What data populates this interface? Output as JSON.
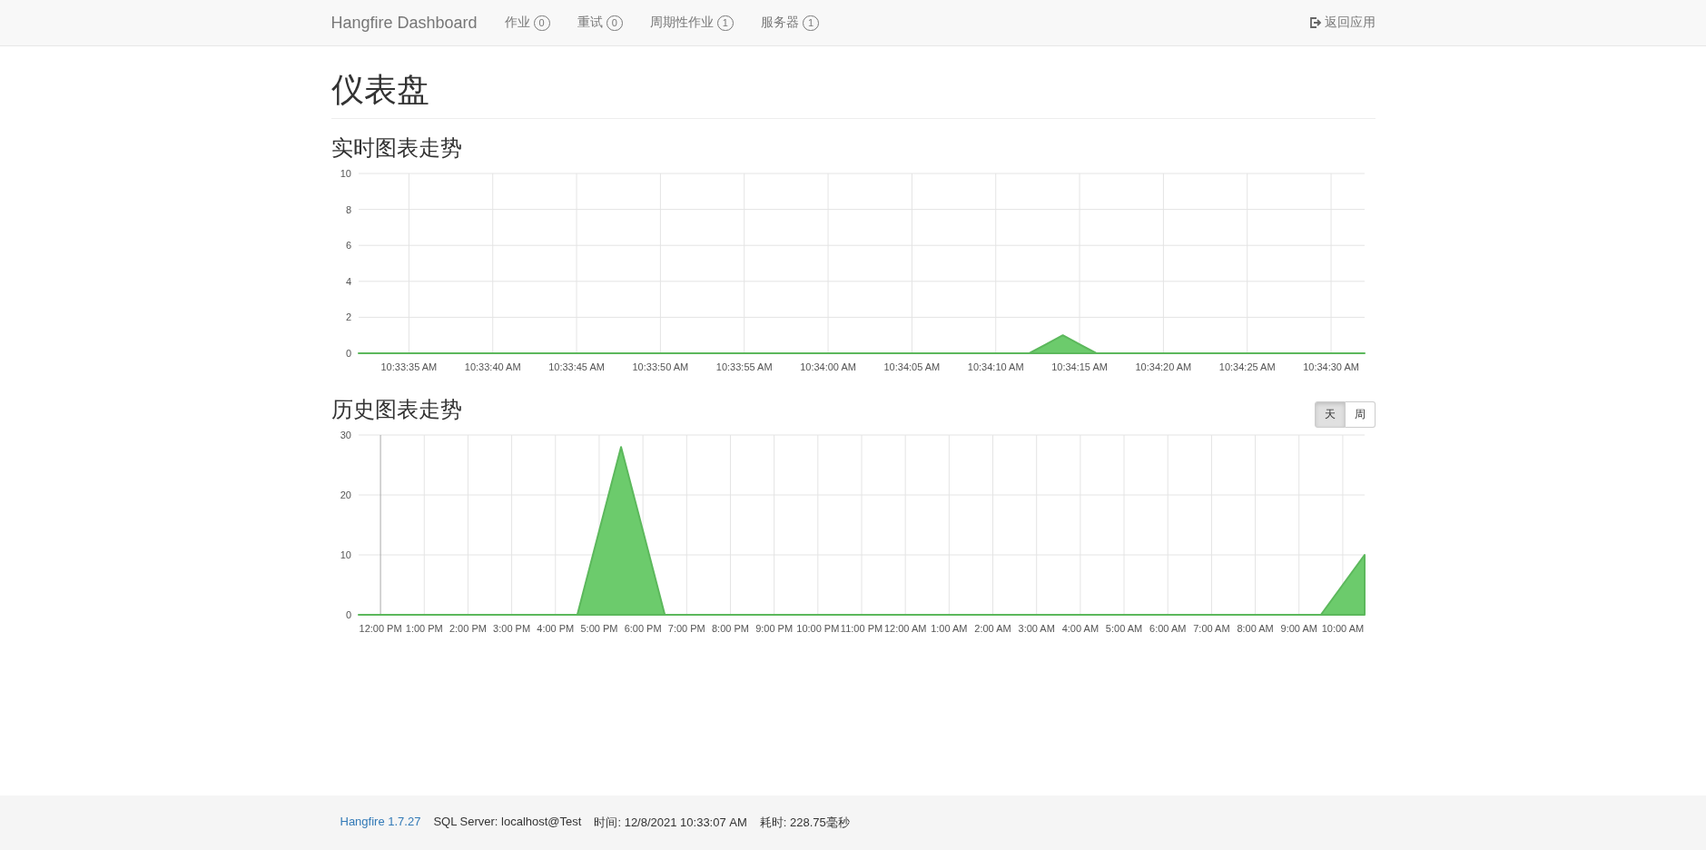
{
  "navbar": {
    "brand": "Hangfire Dashboard",
    "items": [
      {
        "label": "作业",
        "count": "0"
      },
      {
        "label": "重试",
        "count": "0"
      },
      {
        "label": "周期性作业",
        "count": "1"
      },
      {
        "label": "服务器",
        "count": "1"
      }
    ],
    "back_link": "返回应用"
  },
  "page_title": "仪表盘",
  "realtime": {
    "title": "实时图表走势",
    "chart_data": {
      "type": "area",
      "grid": true,
      "ylim": [
        0,
        10
      ],
      "yticks": [
        0,
        2,
        4,
        6,
        8,
        10
      ],
      "categories": [
        null,
        null,
        null,
        "10:33:35 AM",
        null,
        null,
        null,
        null,
        "10:33:40 AM",
        null,
        null,
        null,
        null,
        "10:33:45 AM",
        null,
        null,
        null,
        null,
        "10:33:50 AM",
        null,
        null,
        null,
        null,
        "10:33:55 AM",
        null,
        null,
        null,
        null,
        "10:34:00 AM",
        null,
        null,
        null,
        null,
        "10:34:05 AM",
        null,
        null,
        null,
        null,
        "10:34:10 AM",
        null,
        null,
        null,
        null,
        "10:34:15 AM",
        null,
        null,
        null,
        null,
        "10:34:20 AM",
        null,
        null,
        null,
        null,
        "10:34:25 AM",
        null,
        null,
        null,
        null,
        "10:34:30 AM",
        null,
        null
      ],
      "series": [
        {
          "color": "#6ccb6c",
          "values": [
            0,
            0,
            0,
            0,
            0,
            0,
            0,
            0,
            0,
            0,
            0,
            0,
            0,
            0,
            0,
            0,
            0,
            0,
            0,
            0,
            0,
            0,
            0,
            0,
            0,
            0,
            0,
            0,
            0,
            0,
            0,
            0,
            0,
            0,
            0,
            0,
            0,
            0,
            0,
            0,
            0,
            0.5,
            1,
            0.5,
            0,
            0,
            0,
            0,
            0,
            0,
            0,
            0,
            0,
            0,
            0,
            0,
            0,
            0,
            0,
            0,
            0
          ]
        }
      ]
    }
  },
  "history": {
    "title": "历史图表走势",
    "ranges": [
      {
        "label": "天",
        "selected": true
      },
      {
        "label": "周",
        "selected": false
      }
    ],
    "chart_data": {
      "type": "area",
      "grid": true,
      "ylim": [
        0,
        30
      ],
      "yticks": [
        0,
        10,
        20,
        30
      ],
      "categories": [
        null,
        "12:00 PM",
        null,
        "1:00 PM",
        null,
        "2:00 PM",
        null,
        "3:00 PM",
        null,
        "4:00 PM",
        null,
        "5:00 PM",
        null,
        "6:00 PM",
        null,
        "7:00 PM",
        null,
        "8:00 PM",
        null,
        "9:00 PM",
        null,
        "10:00 PM",
        null,
        "11:00 PM",
        null,
        "12:00 AM",
        null,
        "1:00 AM",
        null,
        "2:00 AM",
        null,
        "3:00 AM",
        null,
        "4:00 AM",
        null,
        "5:00 AM",
        null,
        "6:00 AM",
        null,
        "7:00 AM",
        null,
        "8:00 AM",
        null,
        "9:00 AM",
        null,
        "10:00 AM",
        null
      ],
      "series": [
        {
          "color": "#6ccb6c",
          "values": [
            0,
            0,
            0,
            0,
            0,
            0,
            0,
            0,
            0,
            0,
            0,
            14,
            28,
            14,
            0,
            0,
            0,
            0,
            0,
            0,
            0,
            0,
            0,
            0,
            0,
            0,
            0,
            0,
            0,
            0,
            0,
            0,
            0,
            0,
            0,
            0,
            0,
            0,
            0,
            0,
            0,
            0,
            0,
            0,
            0,
            5,
            10
          ]
        }
      ]
    }
  },
  "footer": {
    "version_link": "Hangfire 1.7.27",
    "storage": "SQL Server: localhost@Test",
    "time": "时间: 12/8/2021 10:33:07 AM",
    "duration": "耗时: 228.75毫秒"
  }
}
